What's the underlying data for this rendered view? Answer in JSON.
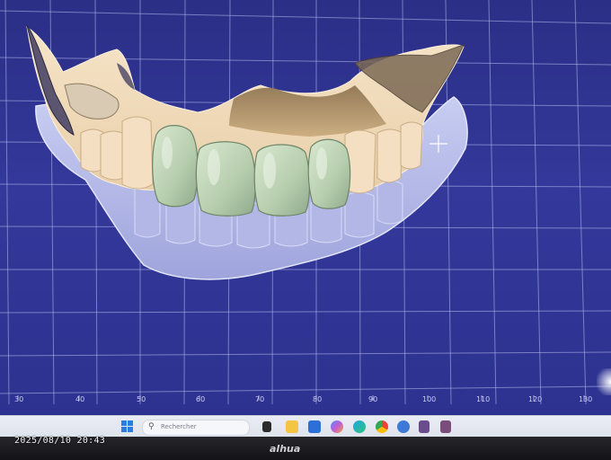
{
  "ruler": {
    "labels": [
      "30",
      "40",
      "50",
      "60",
      "70",
      "80",
      "90",
      "100",
      "110",
      "120",
      "130"
    ]
  },
  "taskbar": {
    "search_placeholder": "Rechercher",
    "icons": [
      "windows-start-icon",
      "search-icon",
      "task-view-icon",
      "file-explorer-icon",
      "store-icon",
      "copilot-icon",
      "edge-icon",
      "chrome-icon",
      "settings-icon",
      "app-icon-1",
      "app-icon-2"
    ]
  },
  "overlay": {
    "timestamp": "2025/08/10 20:43"
  },
  "monitor": {
    "brand": "alhua"
  },
  "colors": {
    "viewport_bg": "#2f3490",
    "grid_line": "#b9bdf0",
    "gingiva_lower": "#b7bce8",
    "stone_upper": "#f2dcc0",
    "stone_shadow": "#a4875f",
    "crown_green": "#bcd3b5"
  }
}
